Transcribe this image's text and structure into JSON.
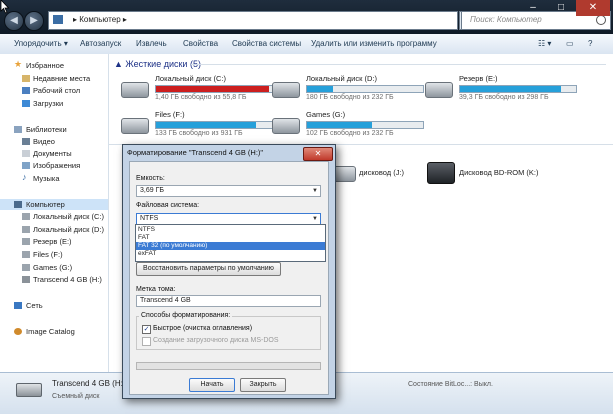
{
  "address": {
    "crumb": "Компьютер",
    "search_placeholder": "Поиск: Компьютер"
  },
  "toolbar": {
    "items": [
      "Упорядочить",
      "Автозапуск",
      "Извлечь",
      "Свойства",
      "Свойства системы",
      "Удалить или изменить программу"
    ]
  },
  "sidebar": {
    "favorites": {
      "label": "Избранное",
      "items": [
        "Недавние места",
        "Рабочий стол",
        "Загрузки"
      ]
    },
    "libraries": {
      "label": "Библиотеки",
      "items": [
        "Видео",
        "Документы",
        "Изображения",
        "Музыка"
      ]
    },
    "computer": {
      "label": "Компьютер",
      "items": [
        "Локальный диск (C:)",
        "Локальный диск (D:)",
        "Резерв (E:)",
        "Files (F:)",
        "Games (G:)",
        "Transcend 4 GB (H:)"
      ]
    },
    "network": "Сеть",
    "image_catalog": "Image Catalog"
  },
  "main": {
    "hdd_header": "Жесткие диски (5)",
    "drives": [
      {
        "name": "Локальный диск (C:)",
        "free": "1,40 ГБ свободно из 55,8 ГБ",
        "used_fraction": 0.97,
        "color": "#cc1f1f"
      },
      {
        "name": "Локальный диск (D:)",
        "free": "180 ГБ свободно из 232 ГБ",
        "used_fraction": 0.22,
        "color": "#26a0da"
      },
      {
        "name": "Резерв (E:)",
        "free": "39,3 ГБ свободно из 298 ГБ",
        "used_fraction": 0.87,
        "color": "#26a0da"
      },
      {
        "name": "Files (F:)",
        "free": "133 ГБ свободно из 931 ГБ",
        "used_fraction": 0.86,
        "color": "#26a0da"
      },
      {
        "name": "Games (G:)",
        "free": "102 ГБ свободно из 232 ГБ",
        "used_fraction": 0.56,
        "color": "#26a0da"
      }
    ],
    "removable": [
      {
        "name": "дисковод (J:)"
      },
      {
        "name": "Дисковод BD-ROM (K:)"
      }
    ]
  },
  "status": {
    "name": "Transcend 4 GB (H:)",
    "type": "Съемный диск",
    "state": "Состояние BitLoc...: Выкл."
  },
  "dialog": {
    "title": "Форматирование \"Transcend 4 GB (H:)\"",
    "capacity_label": "Емкость:",
    "capacity_value": "3,69 ГБ",
    "fs_label": "Файловая система:",
    "fs_value": "NTFS",
    "fs_options": [
      "NTFS",
      "FAT",
      "FAT 32 (по умолчанию)",
      "exFAT"
    ],
    "fs_selected_index": 2,
    "restore_defaults": "Восстановить параметры по умолчанию",
    "volume_label_label": "Метка тома:",
    "volume_label_value": "Transcend 4 GB",
    "format_options_label": "Способы форматирования:",
    "quick_format": "Быстрое (очистка оглавления)",
    "quick_format_checked": true,
    "msdos_disk": "Создание загрузочного диска MS-DOS",
    "start": "Начать",
    "close": "Закрыть"
  }
}
